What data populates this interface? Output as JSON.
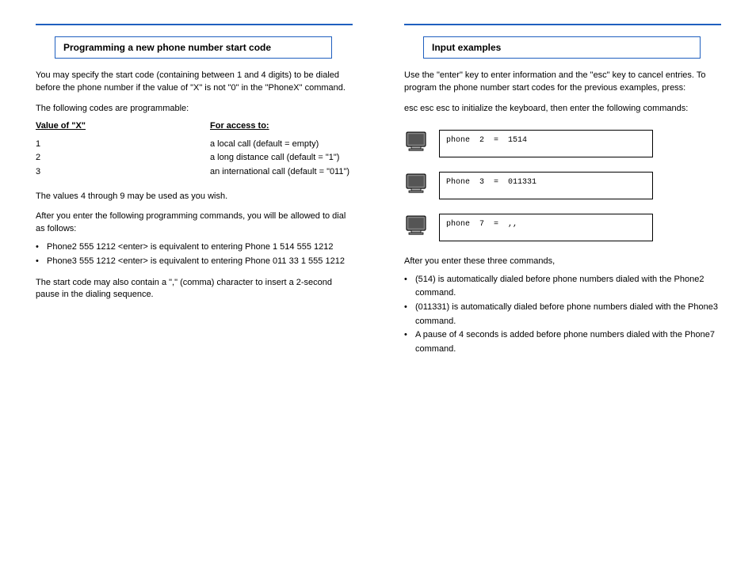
{
  "left": {
    "header_title": "Programming a new phone number start code",
    "intro": "You may specify the start code (containing between 1 and 4 digits) to be dialed before the phone number if the value of \"X\" is not \"0\" in the \"PhoneX\" command.",
    "intro2": "The following codes are programmable:",
    "codes_heading": "Value of \"X\"",
    "codes_heading2": "For access to:",
    "code_rows": [
      {
        "x": "1",
        "desc": "a local call (default = empty)"
      },
      {
        "x": "2",
        "desc": "a long distance call (default = \"1\")"
      },
      {
        "x": "3",
        "desc": "an international call (default = \"011\")"
      }
    ],
    "value_note": "The values 4 through 9 may be used as you wish.",
    "after_intro": "After you enter the following programming commands, you will be allowed to dial as follows:",
    "after_rows": [
      "Phone2 555 1212 <enter>   is equivalent to entering   Phone 1 514 555 1212",
      "Phone3 555 1212 <enter>   is equivalent to entering   Phone 011 33 1 555 1212"
    ],
    "bottom_note": "The start code may also contain a \",\" (comma) character to insert a 2-second pause in the dialing sequence."
  },
  "right": {
    "header_title": "Input examples",
    "intro": "Use the \"enter\" key to enter information and the \"esc\" key to cancel entries. To program the phone number start codes for the previous examples, press:",
    "step1": "esc  esc  esc   to initialize the keyboard, then enter the following commands:",
    "screens": [
      {
        "text": "phone  2  =  1514"
      },
      {
        "text": "Phone  3  =  011331"
      },
      {
        "text": "phone  7  =  ,,"
      }
    ],
    "after1": "After you enter these three commands,",
    "after_items": [
      "(514) is automatically dialed before phone numbers dialed with the Phone2 command.",
      "(011331) is automatically dialed before phone numbers dialed with the Phone3 command.",
      "A pause of 4 seconds is added before phone numbers dialed with the Phone7 command."
    ]
  }
}
